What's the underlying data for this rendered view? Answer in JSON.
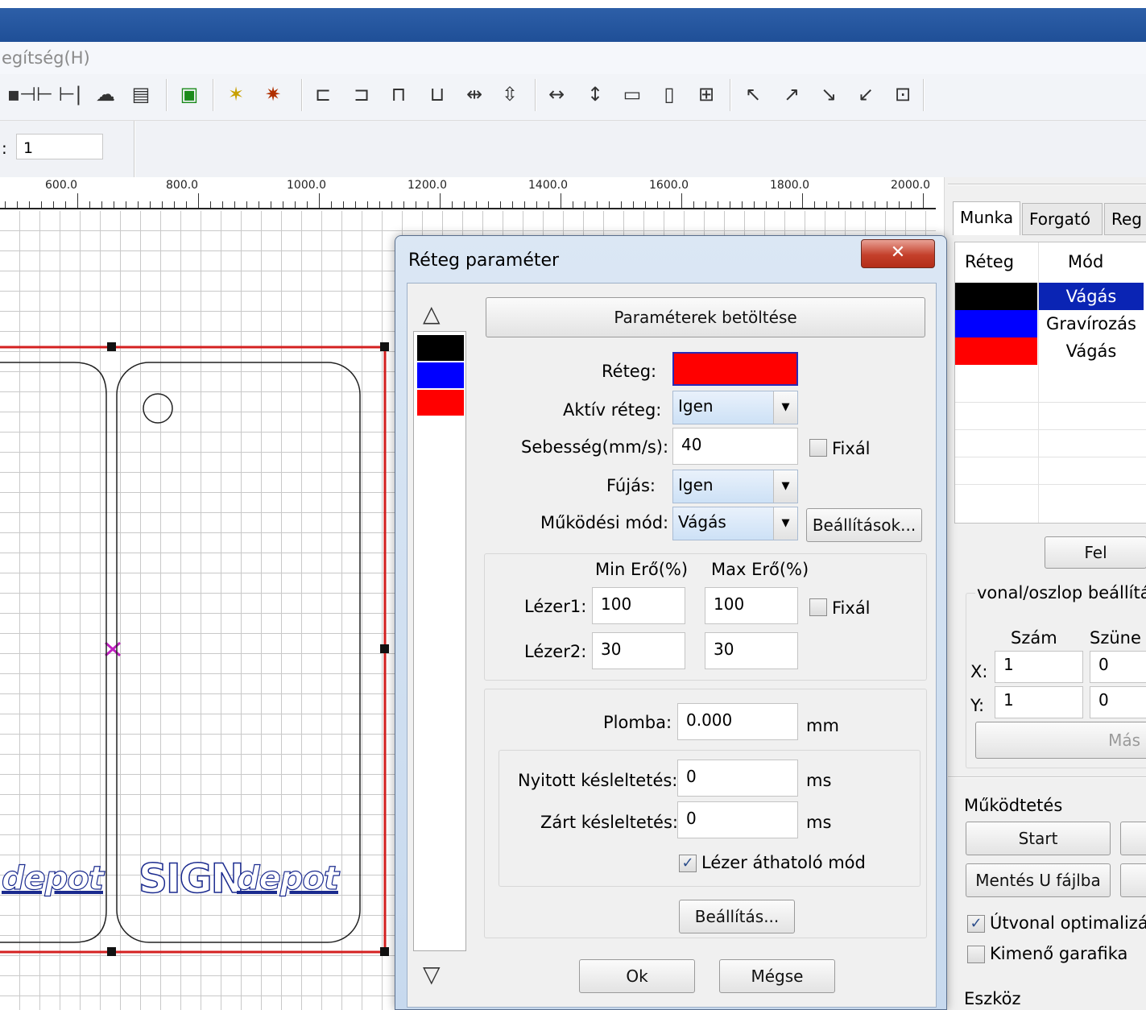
{
  "menubar": {
    "help": "egítség(H)"
  },
  "subbar": {
    "label": ":",
    "value": "1"
  },
  "ruler": {
    "labels": [
      "600.0",
      "800.0",
      "1000.0",
      "1200.0",
      "1400.0",
      "1600.0",
      "1800.0",
      "2000.0"
    ]
  },
  "canvas": {
    "logo_left": "depot",
    "logo_sign": "SIGN",
    "logo_right": "depot"
  },
  "right_panel": {
    "tabs": [
      "Munka",
      "Forgató",
      "Reg"
    ],
    "layer_table": {
      "headers": [
        "Réteg",
        "Mód"
      ],
      "rows": [
        {
          "color": "#000000",
          "mode": "Vágás",
          "selected": true
        },
        {
          "color": "#0000ff",
          "mode": "Gravírozás",
          "selected": false
        },
        {
          "color": "#ff0000",
          "mode": "Vágás",
          "selected": false
        }
      ]
    },
    "up_button": "Fel",
    "grid_group": {
      "title": "vonal/oszlop beállítás",
      "col_count": "Szám",
      "col_pause": "Szüne",
      "x_label": "X:",
      "y_label": "Y:",
      "x_count": "1",
      "x_pause": "0",
      "y_count": "1",
      "y_pause": "0",
      "copy_button": "Más"
    },
    "operation": {
      "title": "Működtetés",
      "start": "Start",
      "save_u": "Mentés U fájlba",
      "path_opt": "Útvonal optimalizálá",
      "path_opt_checked": true,
      "output_graphic": "Kimenő garafika",
      "output_graphic_checked": false,
      "tools": "Eszköz"
    }
  },
  "dialog": {
    "title": "Réteg paraméter",
    "close": "x",
    "load_params": "Paraméterek betöltése",
    "layer_label": "Réteg:",
    "layer_color": "#ff0000",
    "active_label": "Aktív réteg:",
    "active_value": "Igen",
    "speed_label": "Sebesség(mm/s):",
    "speed_value": "40",
    "fix_label": "Fixál",
    "blow_label": "Fújás:",
    "blow_value": "Igen",
    "mode_label": "Működési mód:",
    "mode_value": "Vágás",
    "settings_button": "Beállítások...",
    "min_power": "Min Erő(%)",
    "max_power": "Max Erő(%)",
    "laser1_label": "Lézer1:",
    "laser1_min": "100",
    "laser1_max": "100",
    "laser2_label": "Lézer2:",
    "laser2_min": "30",
    "laser2_max": "30",
    "fix2_label": "Fixál",
    "seal_label": "Plomba:",
    "seal_value": "0.000",
    "seal_unit": "mm",
    "open_delay_label": "Nyitott késleltetés:",
    "open_delay_value": "0",
    "open_delay_unit": "ms",
    "close_delay_label": "Zárt késleltetés:",
    "close_delay_value": "0",
    "close_delay_unit": "ms",
    "through_mode": "Lézer áthatoló mód",
    "through_mode_checked": true,
    "setting_button": "Beállítás...",
    "ok": "Ok",
    "cancel": "Mégse",
    "swatches": [
      "#000000",
      "#0000ff",
      "#ff0000"
    ]
  },
  "colors": {
    "titlebar": "#2458a3",
    "accent_red": "#ff0000",
    "accent_blue": "#0000ff"
  }
}
